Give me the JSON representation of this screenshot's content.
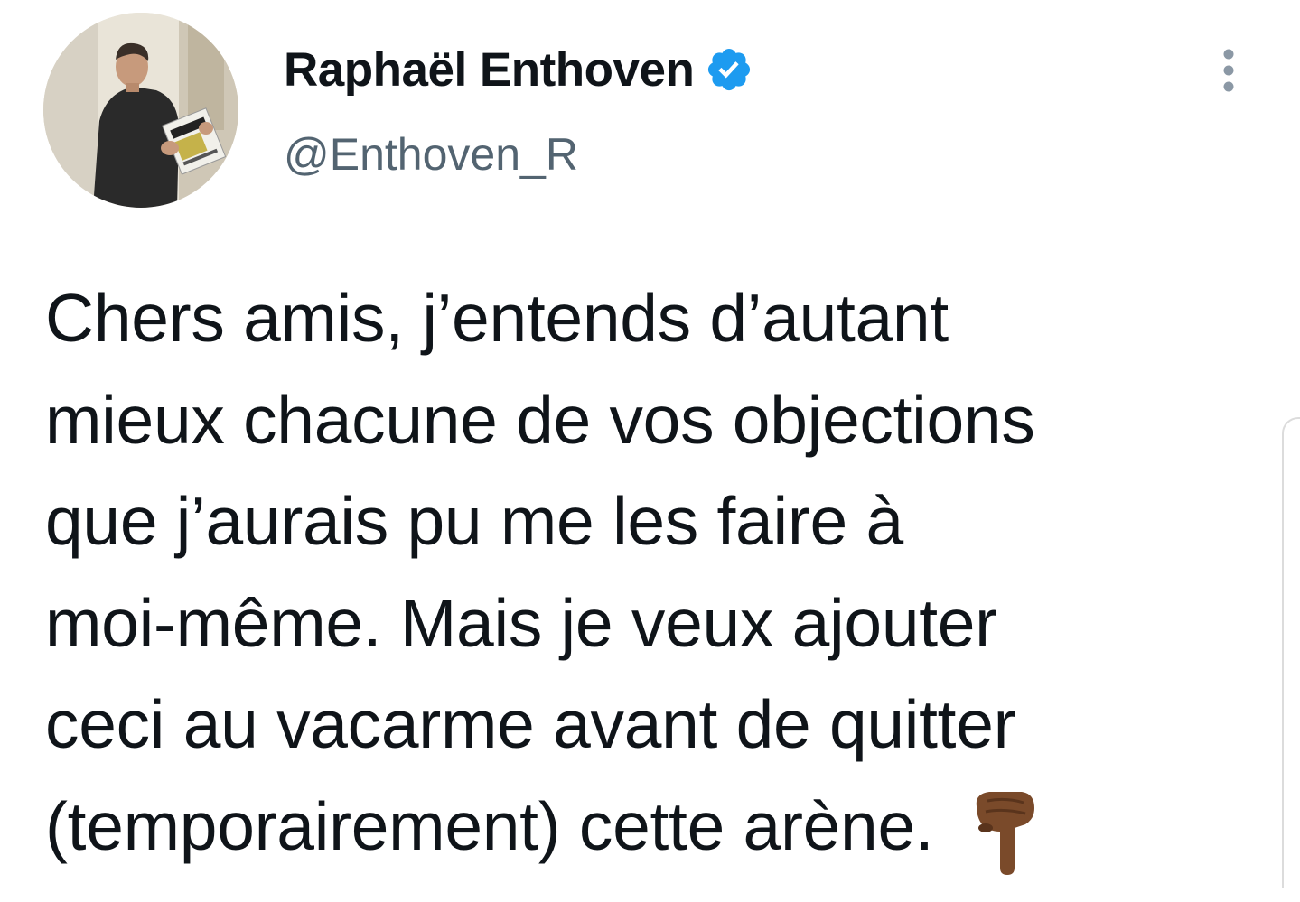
{
  "author": {
    "display_name": "Raphaël Enthoven",
    "handle": "@Enthoven_R",
    "verified": true,
    "avatar_icon": "profile-photo"
  },
  "menu": {
    "icon": "more-vertical-icon"
  },
  "tweet": {
    "lines": [
      "Chers amis, j’entends d’autant",
      "mieux chacune de vos objections",
      "que j’aurais pu me les faire à",
      "moi-même. Mais je veux ajouter",
      "ceci au vacarme avant de quitter",
      "(temporairement) cette arène."
    ],
    "emoji_icon": "backhand-index-pointing-down-icon"
  },
  "colors": {
    "verified_badge": "#1d9bf0",
    "text_primary": "#0f1419",
    "text_secondary": "#536471",
    "emoji_skin": "#7a4a2a"
  }
}
